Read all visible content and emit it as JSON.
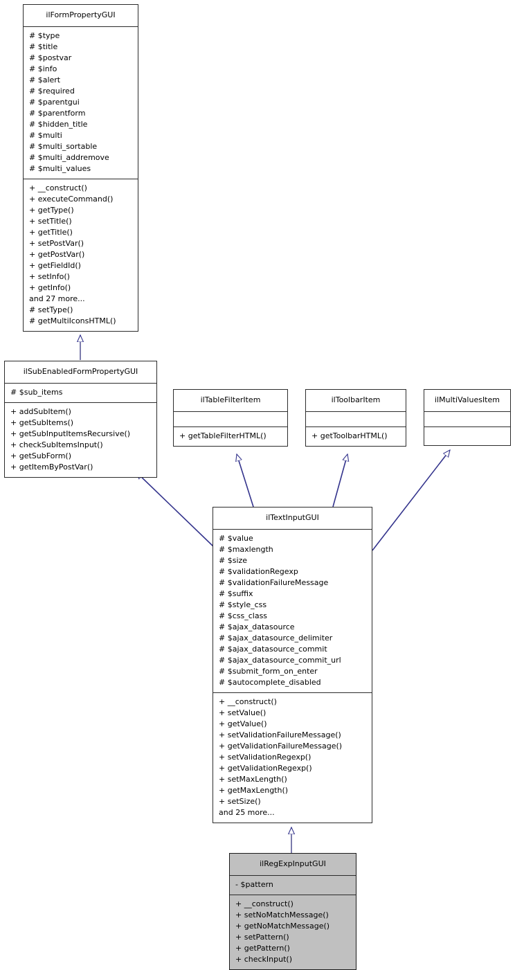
{
  "diagram": {
    "type": "uml-class-inheritance-diagram",
    "title": "ilRegExpInputGUI class hierarchy",
    "edge_color": "#33338c",
    "highlight_fill": "#c0c0c0",
    "box_fill": "#ffffff",
    "border_color": "#2b2b2b"
  },
  "classes": {
    "ilFormPropertyGUI": {
      "name": "ilFormPropertyGUI",
      "highlighted": false,
      "attributes": [
        "# $type",
        "# $title",
        "# $postvar",
        "# $info",
        "# $alert",
        "# $required",
        "# $parentgui",
        "# $parentform",
        "# $hidden_title",
        "# $multi",
        "# $multi_sortable",
        "# $multi_addremove",
        "# $multi_values"
      ],
      "methods": [
        "+ __construct()",
        "+ executeCommand()",
        "+ getType()",
        "+ setTitle()",
        "+ getTitle()",
        "+ setPostVar()",
        "+ getPostVar()",
        "+ getFieldId()",
        "+ setInfo()",
        "+ getInfo()",
        "and 27 more...",
        "# setType()",
        "# getMultiIconsHTML()"
      ]
    },
    "ilSubEnabledFormPropertyGUI": {
      "name": "ilSubEnabledFormPropertyGUI",
      "highlighted": false,
      "attributes": [
        "# $sub_items"
      ],
      "methods": [
        "+ addSubItem()",
        "+ getSubItems()",
        "+ getSubInputItemsRecursive()",
        "+ checkSubItemsInput()",
        "+ getSubForm()",
        "+ getItemByPostVar()"
      ]
    },
    "ilTableFilterItem": {
      "name": "ilTableFilterItem",
      "highlighted": false,
      "attributes": [],
      "methods": [
        "+ getTableFilterHTML()"
      ]
    },
    "ilToolbarItem": {
      "name": "ilToolbarItem",
      "highlighted": false,
      "attributes": [],
      "methods": [
        "+ getToolbarHTML()"
      ]
    },
    "ilMultiValuesItem": {
      "name": "ilMultiValuesItem",
      "highlighted": false,
      "attributes": [],
      "methods": []
    },
    "ilTextInputGUI": {
      "name": "ilTextInputGUI",
      "highlighted": false,
      "attributes": [
        "# $value",
        "# $maxlength",
        "# $size",
        "# $validationRegexp",
        "# $validationFailureMessage",
        "# $suffix",
        "# $style_css",
        "# $css_class",
        "# $ajax_datasource",
        "# $ajax_datasource_delimiter",
        "# $ajax_datasource_commit",
        "# $ajax_datasource_commit_url",
        "# $submit_form_on_enter",
        "# $autocomplete_disabled"
      ],
      "methods": [
        "+ __construct()",
        "+ setValue()",
        "+ getValue()",
        "+ setValidationFailureMessage()",
        "+ getValidationFailureMessage()",
        "+ setValidationRegexp()",
        "+ getValidationRegexp()",
        "+ setMaxLength()",
        "+ getMaxLength()",
        "+ setSize()",
        "and 25 more..."
      ]
    },
    "ilRegExpInputGUI": {
      "name": "ilRegExpInputGUI",
      "highlighted": true,
      "attributes": [
        "- $pattern"
      ],
      "methods": [
        "+ __construct()",
        "+ setNoMatchMessage()",
        "+ getNoMatchMessage()",
        "+ setPattern()",
        "+ getPattern()",
        "+ checkInput()"
      ]
    }
  },
  "relationships": [
    {
      "from": "ilSubEnabledFormPropertyGUI",
      "to": "ilFormPropertyGUI",
      "kind": "inheritance"
    },
    {
      "from": "ilTextInputGUI",
      "to": "ilSubEnabledFormPropertyGUI",
      "kind": "inheritance"
    },
    {
      "from": "ilTextInputGUI",
      "to": "ilTableFilterItem",
      "kind": "inheritance"
    },
    {
      "from": "ilTextInputGUI",
      "to": "ilToolbarItem",
      "kind": "inheritance"
    },
    {
      "from": "ilTextInputGUI",
      "to": "ilMultiValuesItem",
      "kind": "inheritance"
    },
    {
      "from": "ilRegExpInputGUI",
      "to": "ilTextInputGUI",
      "kind": "inheritance"
    }
  ]
}
